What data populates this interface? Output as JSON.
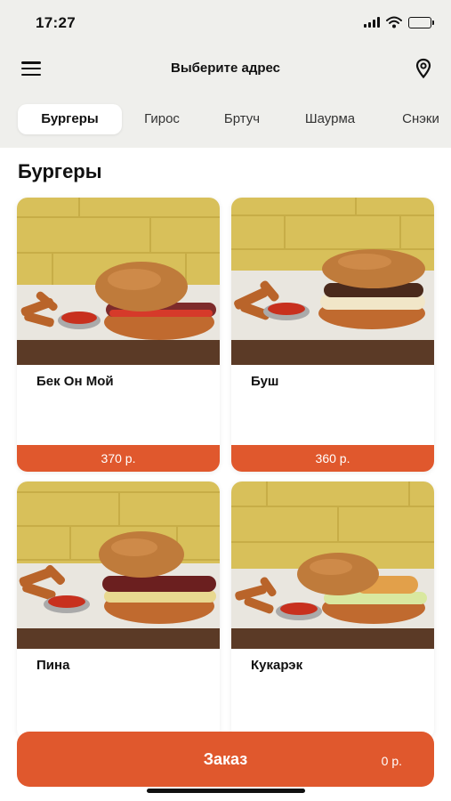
{
  "status_bar": {
    "time": "17:27"
  },
  "nav": {
    "title": "Выберите адрес"
  },
  "tabs": [
    {
      "label": "Бургеры",
      "active": true
    },
    {
      "label": "Гирос"
    },
    {
      "label": "Бртуч"
    },
    {
      "label": "Шаурма"
    },
    {
      "label": "Снэки"
    }
  ],
  "section": {
    "title": "Бургеры"
  },
  "products": [
    {
      "name": "Бек Он Мой",
      "price": "370 р."
    },
    {
      "name": "Буш",
      "price": "360 р."
    },
    {
      "name": "Пина",
      "price": ""
    },
    {
      "name": "Кукарэк",
      "price": ""
    }
  ],
  "order": {
    "label": "Заказ",
    "total": "0 р."
  },
  "colors": {
    "accent": "#e0582d",
    "top_background": "#efefec",
    "wall": "#d8c05a"
  }
}
